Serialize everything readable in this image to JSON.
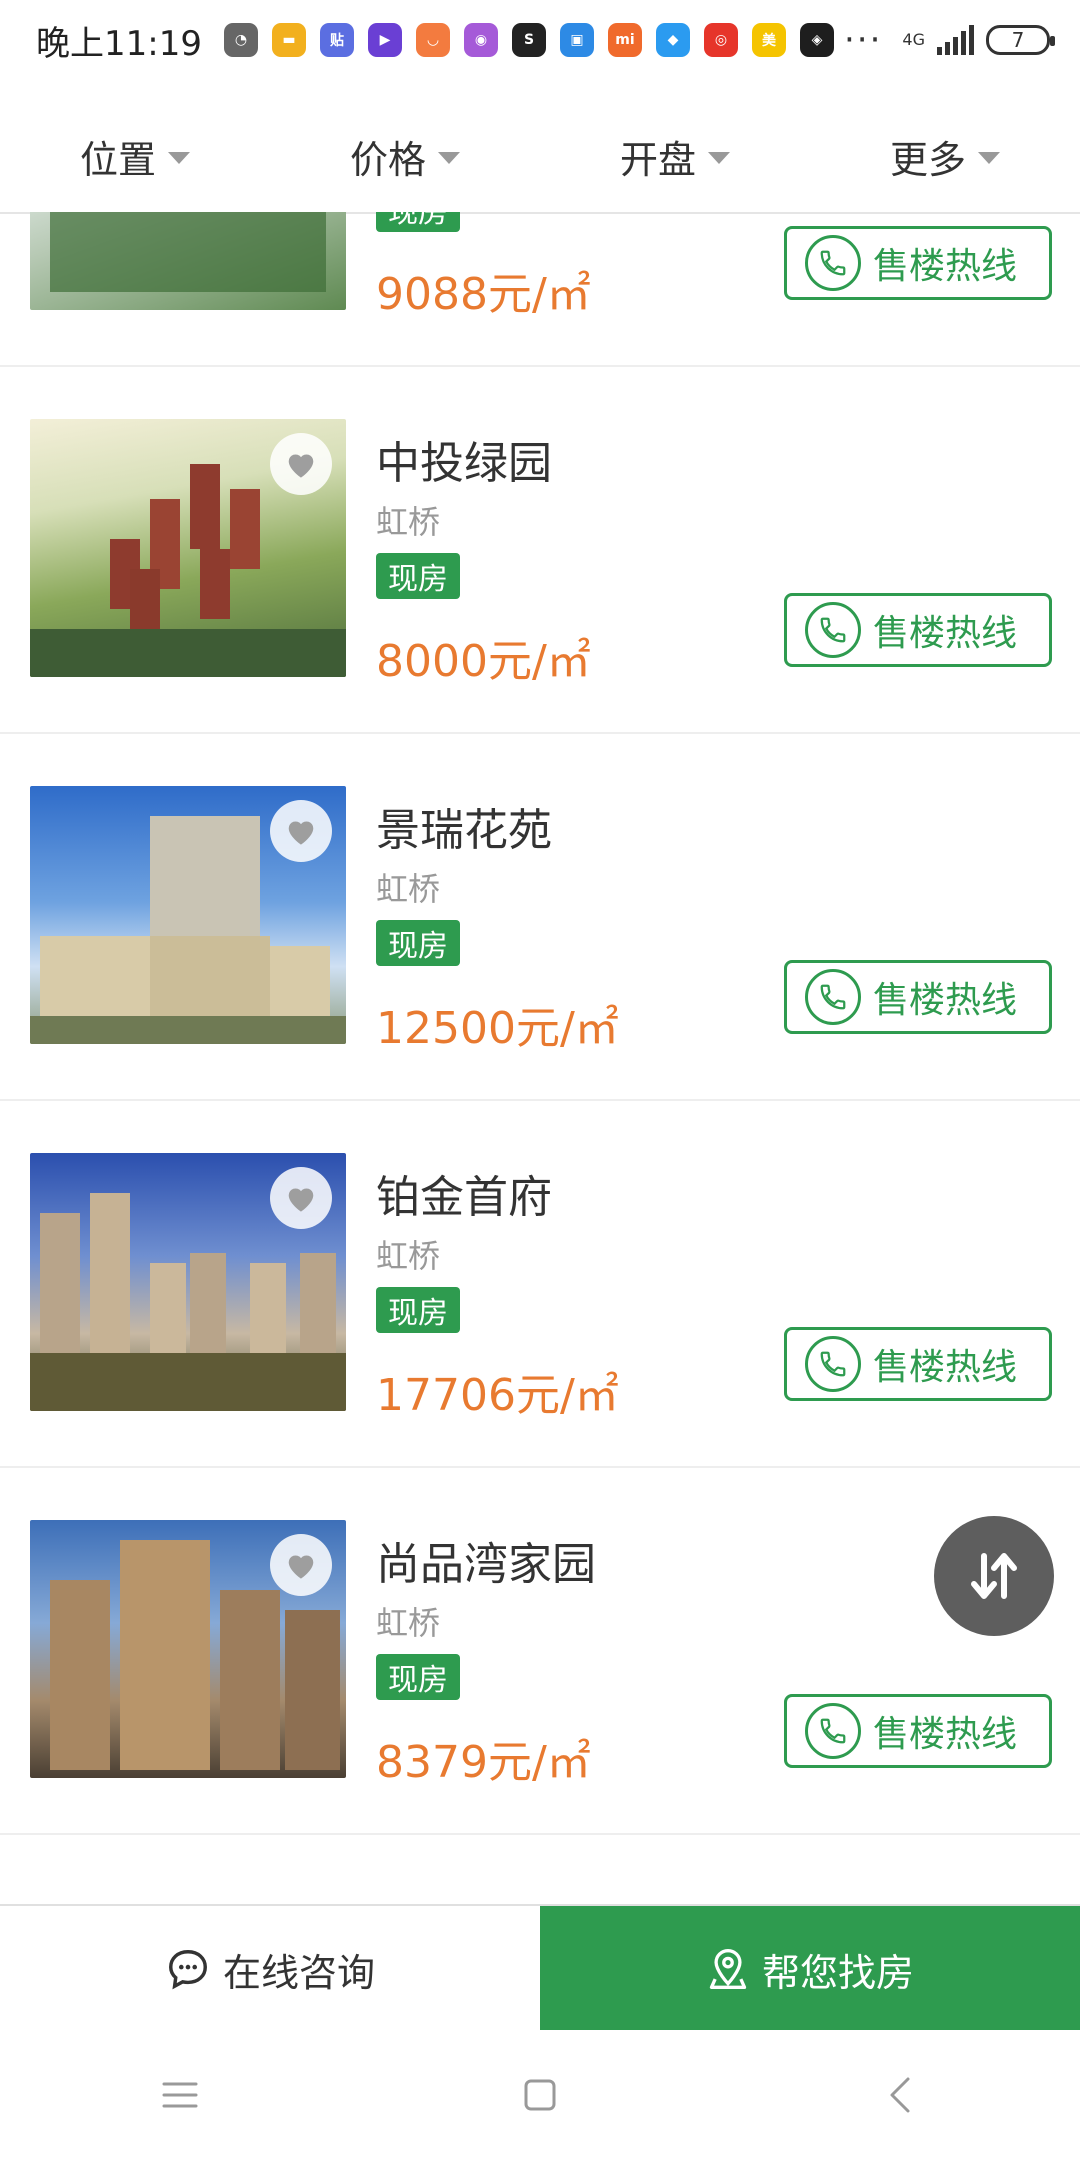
{
  "status_bar": {
    "time": "晚上11:19",
    "app_icons": [
      {
        "name": "qq-icon",
        "color": "#666666",
        "glyph": "◔"
      },
      {
        "name": "app-yellow-icon",
        "color": "#f2b01e",
        "glyph": "▬"
      },
      {
        "name": "tieba-icon",
        "color": "#5b6ee1",
        "glyph": "贴"
      },
      {
        "name": "video-icon",
        "color": "#6a3fd4",
        "glyph": "▶"
      },
      {
        "name": "taobao-icon",
        "color": "#f37b3f",
        "glyph": "◡"
      },
      {
        "name": "chat-icon",
        "color": "#a55ad8",
        "glyph": "◉"
      },
      {
        "name": "soul-icon",
        "color": "#222222",
        "glyph": "S"
      },
      {
        "name": "doc-icon",
        "color": "#2d8ae5",
        "glyph": "▣"
      },
      {
        "name": "mi-icon",
        "color": "#f06a2c",
        "glyph": "mi"
      },
      {
        "name": "app-blue-icon",
        "color": "#2b9bf0",
        "glyph": "◆"
      },
      {
        "name": "weibo-icon",
        "color": "#e6352a",
        "glyph": "◎"
      },
      {
        "name": "meituan-icon",
        "color": "#f5c400",
        "glyph": "美"
      },
      {
        "name": "app-dark-icon",
        "color": "#1e1e1e",
        "glyph": "◈"
      }
    ],
    "more": "···",
    "network": "4G",
    "battery": "7"
  },
  "filters": [
    {
      "label": "位置"
    },
    {
      "label": "价格"
    },
    {
      "label": "开盘"
    },
    {
      "label": "更多"
    }
  ],
  "listings": [
    {
      "name": "",
      "district": "",
      "tag": "现房",
      "price": "9088元/㎡",
      "hotline": "售楼热线"
    },
    {
      "name": "中投绿园",
      "district": "虹桥",
      "tag": "现房",
      "price": "8000元/㎡",
      "hotline": "售楼热线"
    },
    {
      "name": "景瑞花苑",
      "district": "虹桥",
      "tag": "现房",
      "price": "12500元/㎡",
      "hotline": "售楼热线"
    },
    {
      "name": "铂金首府",
      "district": "虹桥",
      "tag": "现房",
      "price": "17706元/㎡",
      "hotline": "售楼热线"
    },
    {
      "name": "尚品湾家园",
      "district": "虹桥",
      "tag": "现房",
      "price": "8379元/㎡",
      "hotline": "售楼热线"
    }
  ],
  "actions": {
    "consult": "在线咨询",
    "find": "帮您找房"
  },
  "colors": {
    "accent_green": "#2e9b4f",
    "price_orange": "#e87a30"
  }
}
